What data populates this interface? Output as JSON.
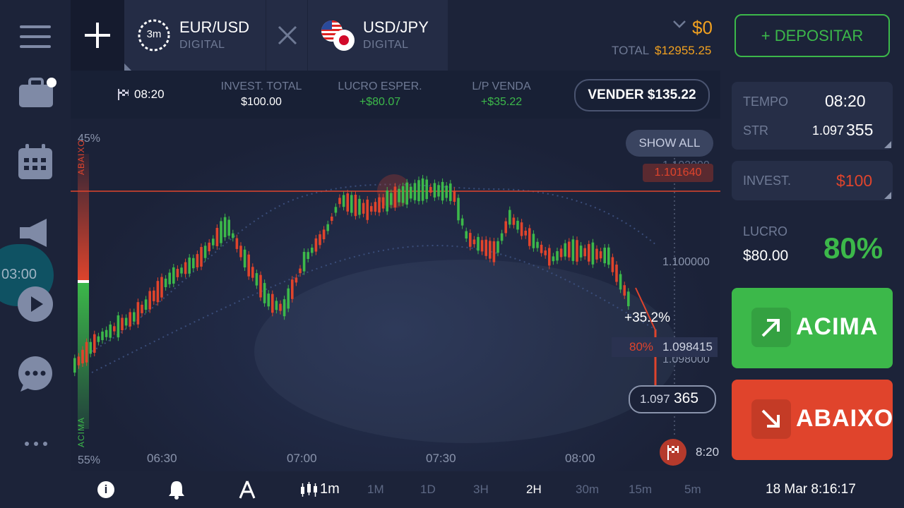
{
  "sidebar": {
    "menu_icon": "hamburger-icon",
    "portfolio_icon": "briefcase-icon",
    "calendar_icon": "calendar-icon",
    "news_icon": "megaphone-icon",
    "timer_label": "03:00",
    "play_icon": "play-icon",
    "chat_icon": "chat-icon",
    "more_icon": "more-dots-icon"
  },
  "topbar": {
    "add_tab_icon": "plus-icon",
    "tabs": [
      {
        "title": "EUR/USD",
        "subtitle": "DIGITAL",
        "badge": "3m"
      },
      {
        "title": "USD/JPY",
        "subtitle": "DIGITAL"
      }
    ],
    "close_icon": "close-icon",
    "balance": "$0",
    "total_label": "TOTAL",
    "total_value": "$12955.25",
    "deposit_label": "+ DEPOSITAR"
  },
  "infobar": {
    "expiry_time": "08:20",
    "invest_label": "INVEST. TOTAL",
    "invest_value": "$100.00",
    "profit_label": "LUCRO ESPER.",
    "profit_value": "+$80.07",
    "pl_label": "L/P VENDA",
    "pl_value": "+$35.22",
    "sell_label": "VENDER $135.22"
  },
  "chart": {
    "show_all_label": "SHOW ALL",
    "top_pct": "45%",
    "bottom_pct": "55%",
    "side_top_label": "ABAIXO",
    "side_bottom_label": "ACIMA",
    "price_ticks": [
      "1.102000",
      "1.100000",
      "1.098000"
    ],
    "strike_price": "1.101640",
    "current_price_label": "1.098415",
    "payout_pct": "80%",
    "profit_pct": "+35.2%",
    "live_price_main": "1.097",
    "live_price_tail": "365",
    "time_ticks": [
      "06:30",
      "07:00",
      "07:30",
      "08:00"
    ],
    "expiry_marker": "8:20"
  },
  "chart_data": {
    "type": "candlestick",
    "ylim": [
      1.0965,
      1.1025
    ],
    "strike": 1.10164,
    "current": 1.098415
  },
  "rpanel": {
    "time_label": "TEMPO",
    "time_value": "08:20",
    "str_label": "STR",
    "str_main": "1.097",
    "str_tail": "355",
    "invest_label": "INVEST.",
    "invest_value": "$100",
    "profit_label": "LUCRO",
    "profit_value": "$80.00",
    "profit_pct": "80%",
    "up_label": "ACIMA",
    "down_label": "ABAIXO"
  },
  "bottombar": {
    "timeframe_label": "1m",
    "timeframes": [
      "1M",
      "1D",
      "3H",
      "2H",
      "30m",
      "15m",
      "5m"
    ],
    "active_timeframe": "2H",
    "datetime": "18 Mar 8:16:17"
  },
  "colors": {
    "green": "#3cb84a",
    "red": "#e0442c",
    "orange": "#f0a020",
    "background": "#1a2036"
  }
}
